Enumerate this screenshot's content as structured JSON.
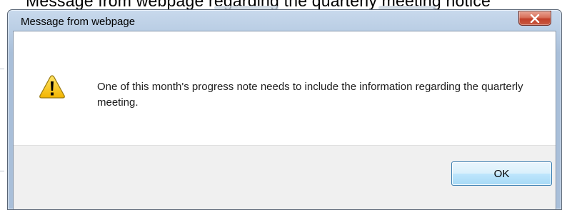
{
  "background": {
    "heading": "Message from webpage regarding the quarterly meeting notice"
  },
  "dialog": {
    "title": "Message from webpage",
    "close_icon": "close-icon",
    "warning_icon": "warning-icon",
    "message": "One of this month's progress note needs to include the information regarding the quarterly meeting.",
    "ok_label": "OK"
  },
  "colors": {
    "close_button": "#c8492f",
    "ok_button_border": "#3c7fb1",
    "warning_fill": "#f4c400"
  }
}
